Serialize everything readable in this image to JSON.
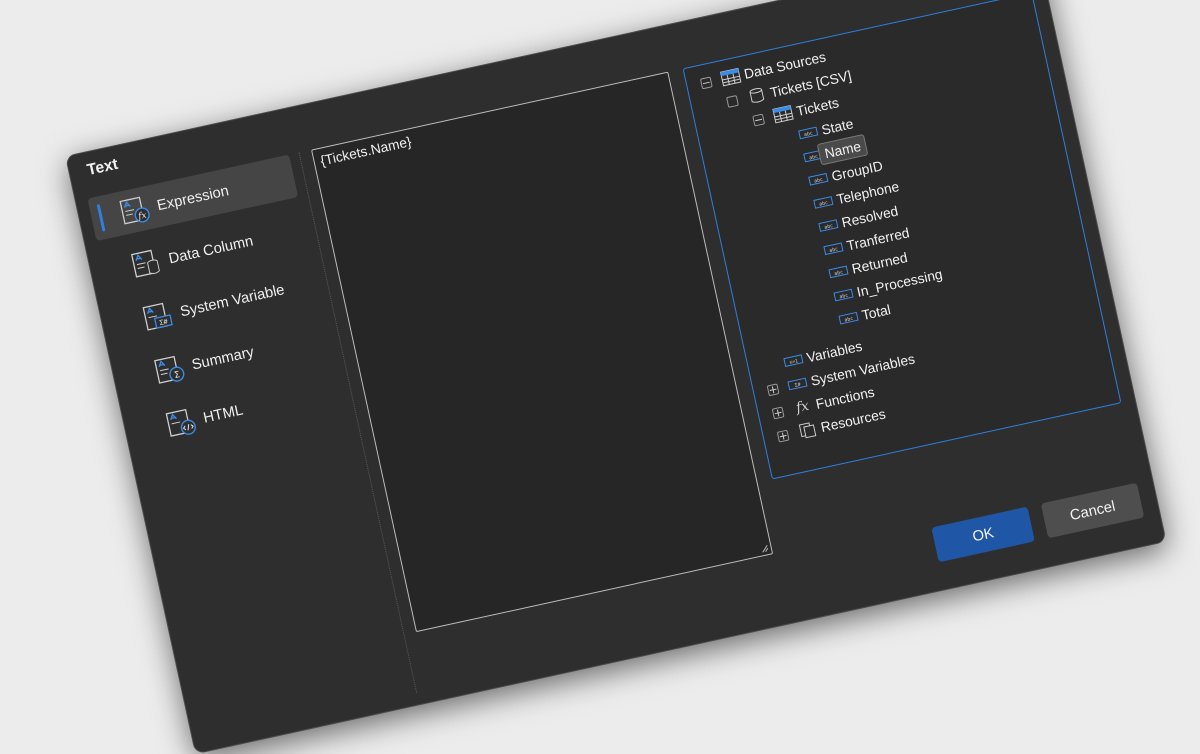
{
  "dialog": {
    "title": "Text"
  },
  "nav": {
    "items": [
      {
        "label": "Expression",
        "icon": "expression-icon"
      },
      {
        "label": "Data Column",
        "icon": "data-column-icon"
      },
      {
        "label": "System Variable",
        "icon": "system-variable-icon"
      },
      {
        "label": "Summary",
        "icon": "summary-icon"
      },
      {
        "label": "HTML",
        "icon": "html-icon"
      }
    ],
    "selected": "Expression"
  },
  "editor": {
    "value": "{Tickets.Name}"
  },
  "tree": {
    "data_sources": "Data Sources",
    "tickets_csv": "Tickets [CSV]",
    "tickets": "Tickets",
    "columns": [
      "State",
      "Name",
      "GroupID",
      "Telephone",
      "Resolved",
      "Tranferred",
      "Returned",
      "In_Processing",
      "Total"
    ],
    "selected_column": "Name",
    "variables": "Variables",
    "system_variables": "System Variables",
    "functions": "Functions",
    "resources": "Resources"
  },
  "buttons": {
    "ok": "OK",
    "cancel": "Cancel"
  },
  "colors": {
    "accent": "#2f7fe0",
    "ok_button": "#1f56a6",
    "dialog_bg": "#2e2e2e"
  }
}
